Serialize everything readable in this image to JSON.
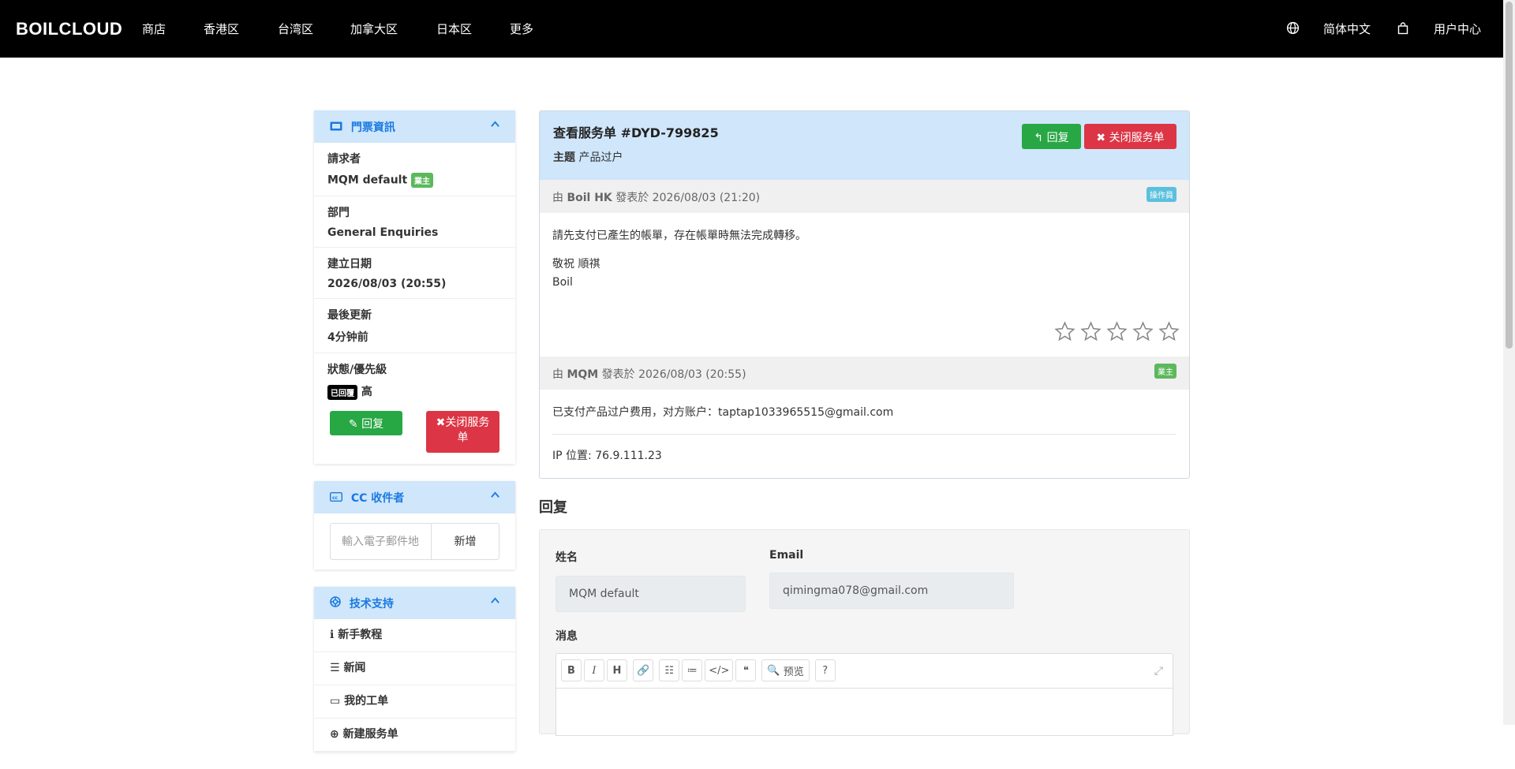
{
  "nav": {
    "brand": "BOILCLOUD",
    "links": [
      "商店",
      "香港区",
      "台湾区",
      "加拿大区",
      "日本区",
      "更多"
    ],
    "language": "简体中文",
    "user_center": "用户中心",
    "icons": [
      "globe-icon",
      "shopping-bag-icon"
    ]
  },
  "ticket_info": {
    "heading": "門票資訊",
    "requester_label": "請求者",
    "requester_value": "MQM default",
    "requester_badge": "業主",
    "department_label": "部門",
    "department_value": "General Enquiries",
    "created_label": "建立日期",
    "created_value": "2026/08/03 (20:55)",
    "updated_label": "最後更新",
    "updated_value": "4分钟前",
    "status_label": "狀態/優先級",
    "status_badge": "已回覆",
    "priority_value": "高",
    "reply_btn": "回复",
    "close_btn": "关闭服务单"
  },
  "cc": {
    "heading": "CC 收件者",
    "placeholder": "輸入電子郵件地",
    "add_btn": "新增"
  },
  "support": {
    "heading": "技术支持",
    "items": [
      "新手教程",
      "新闻",
      "我的工单",
      "新建服务单"
    ]
  },
  "ticket": {
    "title": "查看服务单 #DYD-799825",
    "subject_label": "主题",
    "subject_value": "产品过户",
    "reply_btn": "回复",
    "close_btn": "关闭服务单"
  },
  "messages": [
    {
      "prefix": "由",
      "author": "Boil HK",
      "posted": "發表於 2026/08/03 (21:20)",
      "role": "操作員",
      "role_color": "#5bc0de",
      "body_line1": "請先支付已產生的帳單，存在帳單時無法完成轉移。",
      "body_line2": "敬祝 順祺",
      "body_line3": "Boil",
      "rating": 0,
      "rating_max": 5
    },
    {
      "prefix": "由",
      "author": "MQM",
      "posted": "發表於 2026/08/03 (20:55)",
      "role": "業主",
      "role_color": "#5cb85c",
      "body_line1": "已支付产品过户费用，对方账户：taptap1033965515@gmail.com",
      "ip": "IP 位置: 76.9.111.23"
    }
  ],
  "reply_form": {
    "title": "回复",
    "name_label": "姓名",
    "name_value": "MQM default",
    "email_label": "Email",
    "email_value": "qimingma078@gmail.com",
    "message_label": "消息",
    "toolbar": [
      "B",
      "I",
      "H",
      "link-icon",
      "bullet-list-icon",
      "numbered-list-icon",
      "code-icon",
      "quote-icon",
      "预览",
      "help-icon"
    ]
  },
  "colors": {
    "accent": "#1a7ae0",
    "header_bg": "#cfe6fb",
    "green": "#28a745",
    "red": "#dc3545"
  }
}
